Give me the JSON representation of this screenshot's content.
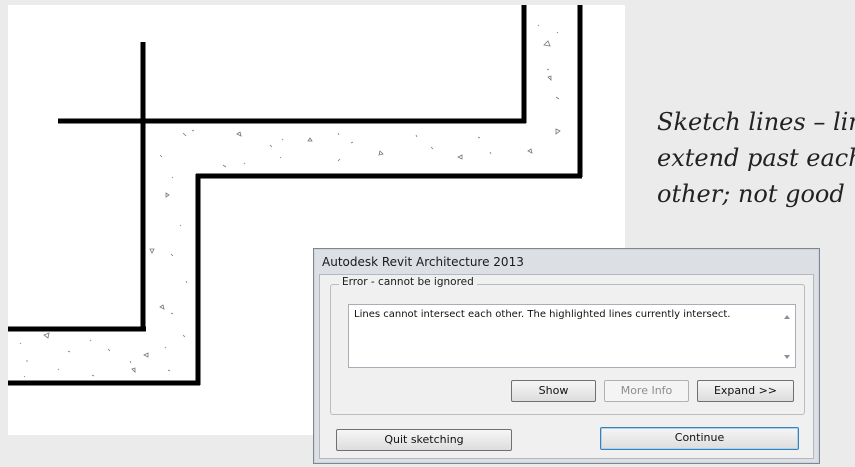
{
  "caption": {
    "line1": "Sketch lines – lines",
    "line2": "extend past each",
    "line3": "other; not good"
  },
  "dialog": {
    "title": "Autodesk Revit Architecture 2013",
    "group_label": "Error - cannot be ignored",
    "message": "Lines cannot intersect each other. The highlighted lines currently intersect.",
    "buttons": {
      "show": "Show",
      "more_info": "More Info",
      "expand": "Expand >>",
      "quit_sketching": "Quit sketching",
      "continue": "Continue"
    }
  }
}
